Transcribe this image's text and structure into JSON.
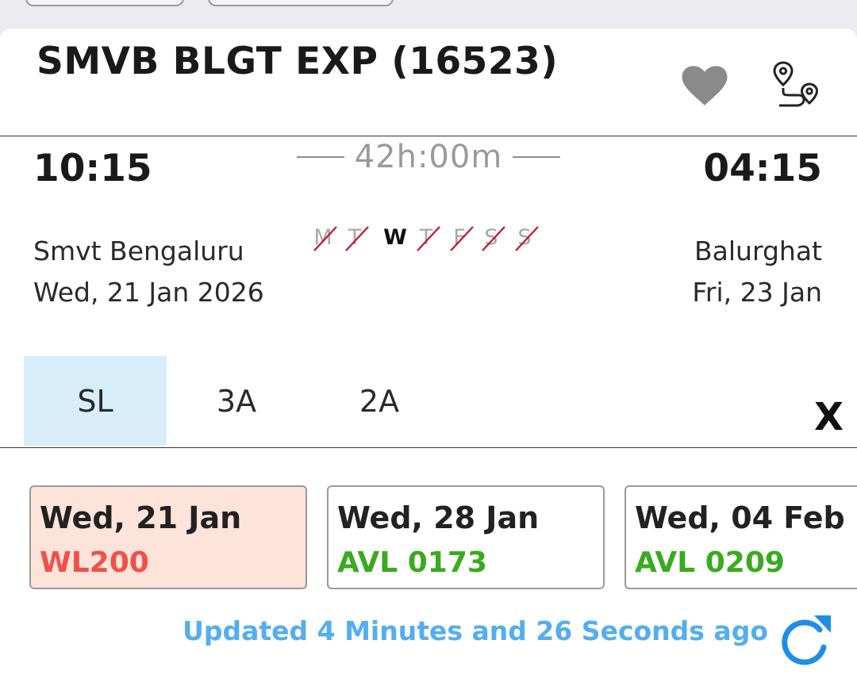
{
  "train": {
    "name": "SMVB BLGT EXP (16523)"
  },
  "icons": {
    "favorite": "heart-icon",
    "route": "route-icon"
  },
  "journey": {
    "departure_time": "10:15",
    "arrival_time": "04:15",
    "duration": "42h:00m",
    "from_station": "Smvt Bengaluru",
    "from_date": "Wed, 21 Jan  2026",
    "to_station": "Balurghat",
    "to_date": "Fri, 23 Jan",
    "run_days": [
      {
        "label": "M",
        "runs": false
      },
      {
        "label": "T",
        "runs": false
      },
      {
        "label": "W",
        "runs": true
      },
      {
        "label": "T",
        "runs": false
      },
      {
        "label": "F",
        "runs": false
      },
      {
        "label": "S",
        "runs": false
      },
      {
        "label": "S",
        "runs": false
      }
    ]
  },
  "classes": [
    {
      "label": "SL",
      "active": true
    },
    {
      "label": "3A",
      "active": false
    },
    {
      "label": "2A",
      "active": false
    }
  ],
  "close_label": "X",
  "availability": [
    {
      "date": "Wed, 21 Jan",
      "status": "WL200",
      "status_color": "#f0504a",
      "selected": true
    },
    {
      "date": "Wed, 28 Jan",
      "status": "AVL 0173",
      "status_color": "#3aaa1e",
      "selected": false
    },
    {
      "date": "Wed, 04 Feb",
      "status": "AVL 0209",
      "status_color": "#3aaa1e",
      "selected": false
    }
  ],
  "updated_text": "Updated 4 Minutes and 26 Seconds ago",
  "colors": {
    "accent": "#52aef0",
    "active_tab": "#d7eef9",
    "selected_card": "#fde3d9",
    "strike": "#c8102e"
  }
}
